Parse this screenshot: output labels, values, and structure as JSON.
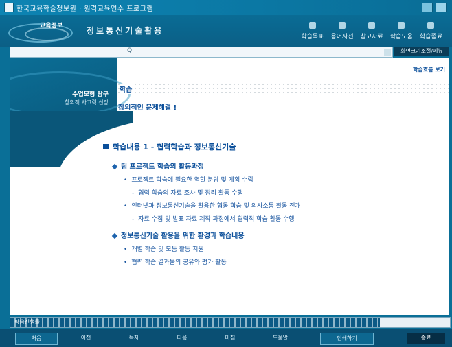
{
  "window": {
    "title": "한국교육학술정보원 · 원격교육연수 프로그램"
  },
  "header": {
    "logo_text": "교육정보",
    "course_title": "정보통신기술활용",
    "menu": [
      "학습목표",
      "용어사전",
      "참고자료",
      "학습도움",
      "학습종료"
    ]
  },
  "addressbar": {
    "url": "Q",
    "tool_label": "화면크기조절/메뉴"
  },
  "content": {
    "left_unit": "수업모형 탐구",
    "left_sub": "창의적 사고력 신장",
    "page_indicator": "학습흐름 보기",
    "topic": "학습",
    "lesson_title": "창의적인 문제해결 !",
    "section_title": "학습내용 1 - 협력학습과 정보통신기술",
    "items": [
      {
        "level": 1,
        "text": "팀 프로젝트 학습의 활동과정"
      },
      {
        "level": 2,
        "text": "프로젝트 학습에 필요한 역할 분담 및 계획 수립"
      },
      {
        "level": 3,
        "text": "협력 학습의 자료 조사 및 정리 활동 수행"
      },
      {
        "level": 2,
        "text": "인터넷과 정보통신기술을 활용한 협동 학습 및 의사소통 활동 전개"
      },
      {
        "level": 3,
        "text": "자료 수집 및 발표 자료 제작 과정에서 협력적 학습 활동 수행"
      },
      {
        "level": 1,
        "text": "정보통신기술 활용을 위한 환경과 학습내용"
      },
      {
        "level": 2,
        "text": "개별 학습 및 모둠 활동 지원"
      },
      {
        "level": 2,
        "text": "협력 학습 결과물의 공유와 평가 활동"
      }
    ]
  },
  "progress": {
    "label": "학습진행률",
    "percent": 84
  },
  "navbar": {
    "buttons": [
      "처음",
      "이전",
      "목차",
      "다음",
      "마침",
      "도움말",
      "인쇄하기",
      "종료"
    ]
  }
}
